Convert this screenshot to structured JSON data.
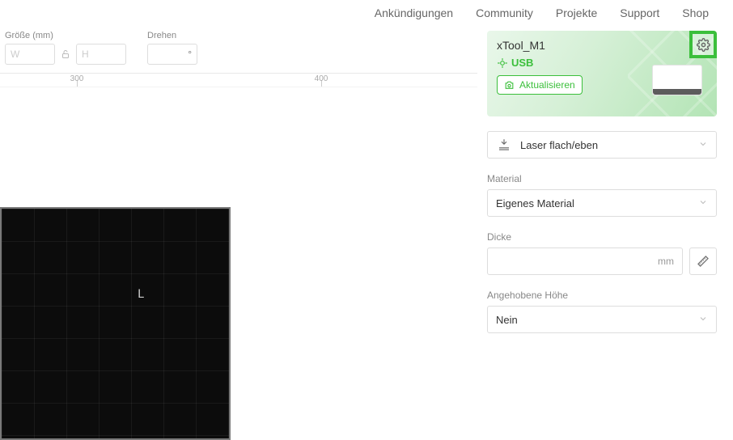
{
  "nav": {
    "items": [
      "Ankündigungen",
      "Community",
      "Projekte",
      "Support",
      "Shop"
    ]
  },
  "props": {
    "size_label": "Größe (mm)",
    "rotate_label": "Drehen",
    "w_placeholder": "W",
    "h_placeholder": "H",
    "deg_placeholder": "°"
  },
  "ruler": {
    "marks": [
      {
        "pos": 95,
        "label": "300"
      },
      {
        "pos": 397,
        "label": "400"
      }
    ]
  },
  "device": {
    "name": "xTool_M1",
    "connection": "USB",
    "refresh": "Aktualisieren"
  },
  "mode": {
    "value": "Laser flach/eben"
  },
  "material": {
    "label": "Material",
    "value": "Eigenes Material"
  },
  "thickness": {
    "label": "Dicke",
    "unit": "mm",
    "value": ""
  },
  "raised": {
    "label": "Angehobene Höhe",
    "value": "Nein"
  }
}
